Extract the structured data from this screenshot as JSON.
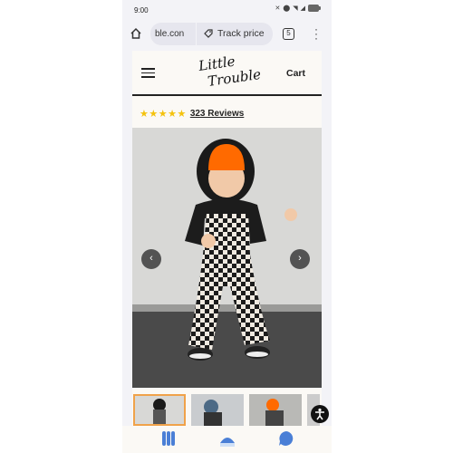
{
  "status_bar": {
    "time": "9:00",
    "battery": "4"
  },
  "browser": {
    "url": "ble.con",
    "track_price_label": "Track price",
    "tab_count": "5"
  },
  "site": {
    "cart_label": "Cart",
    "logo_text": "Little Trouble",
    "rating": {
      "stars": "★★★★★",
      "reviews_label": "323 Reviews"
    }
  },
  "gallery": {
    "prev_label": "‹",
    "next_label": "›"
  },
  "colors": {
    "star": "#f4c20d",
    "thumb_active_border": "#f0a24a",
    "hat_orange": "#ff6a00"
  }
}
